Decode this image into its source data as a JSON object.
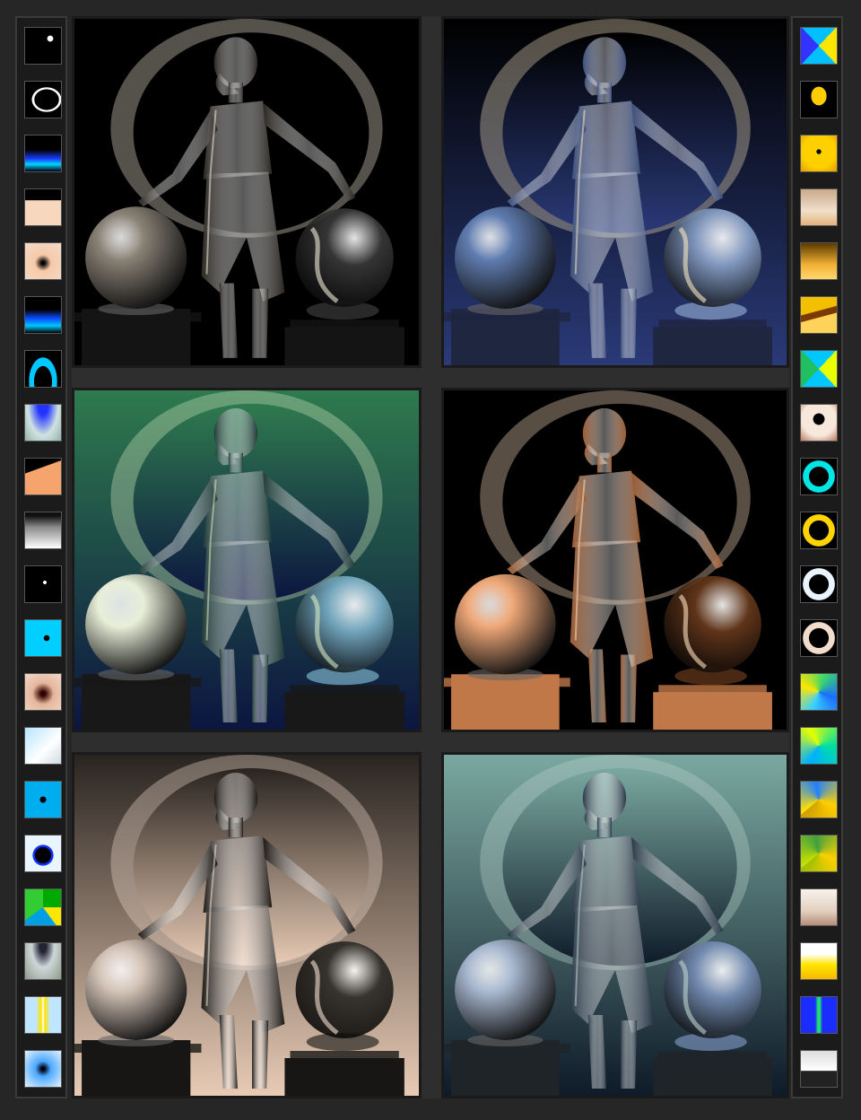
{
  "colors": {
    "background": "#262626",
    "strip": "#1b1b1b",
    "strip_border": "#3a3a3a"
  },
  "left_strip": {
    "thumbnails": [
      {
        "name": "crescent-small-preset",
        "bg": "radial-gradient(circle at 70% 30%, #ffffff 0 8%, #000 9%)"
      },
      {
        "name": "crescent-wide-preset",
        "bg": "radial-gradient(ellipse at 60% 50%, #000 0 40%, #fff 41% 48%, #000 49%)"
      },
      {
        "name": "blue-horizon-preset",
        "bg": "linear-gradient(#000 40%, #1a3cff 65%, #00d7ff 80%, #001 100%)"
      },
      {
        "name": "peach-arch-preset",
        "bg": "linear-gradient(#000 30%, #f8d7bf 31%)"
      },
      {
        "name": "peach-spot-preset",
        "bg": "radial-gradient(circle at 50% 55%, #000 0 6%, #f7c9a8 30%, #f1dccb 100%)"
      },
      {
        "name": "cyan-horizon-preset",
        "bg": "linear-gradient(#000 35%, #0a4cff 60%, #00c8ff 80%, #000 100%)"
      },
      {
        "name": "cyan-arc-preset",
        "bg": "radial-gradient(ellipse at 50% 85%, #000 0 35%, #00c8ff 36% 55%, #000 56%)"
      },
      {
        "name": "teal-dome-preset",
        "bg": "radial-gradient(ellipse at 50% 0%, #2233ff 0 20%, #cfe3e0 60%, #95b0a8 100%)"
      },
      {
        "name": "orange-peak-preset",
        "bg": "linear-gradient(160deg, #000 0 30%, #f4a46c 31% 100%)"
      },
      {
        "name": "white-cone-preset",
        "bg": "linear-gradient(#111 0 10%, #888 40%, #fff 100%)"
      },
      {
        "name": "tiny-moon-preset",
        "bg": "radial-gradient(circle at 55% 45%, #fff 0 6%, #000 7%)"
      },
      {
        "name": "cyan-dot-preset",
        "bg": "radial-gradient(circle at 60% 50%, #000 0 10%, #00cfff 11% 100%)"
      },
      {
        "name": "peach-shadow-preset",
        "bg": "radial-gradient(circle at 50% 55%, #300 0 8%, #e5b69b 40%, #f0d8c8 100%)"
      },
      {
        "name": "ice-gradient-preset",
        "bg": "linear-gradient(135deg, #b7e6ff, #ffffff 60%, #cfd9e0)"
      },
      {
        "name": "blue-dot-preset",
        "bg": "radial-gradient(circle at 50% 50%, #000 0 12%, #00aeef 13% 100%)"
      },
      {
        "name": "dark-eye-preset",
        "bg": "radial-gradient(circle at 50% 55%, #000 0 30%, #1030ff 31% 38%, #e9f6ff 40% 100%)"
      },
      {
        "name": "green-spiral-preset",
        "bg": "conic-gradient(#0a0 0 25%, #ffe600 25% 40%, #009ee3 40% 65%, #3c3 65% 100%)"
      },
      {
        "name": "gray-dome-preset",
        "bg": "radial-gradient(ellipse at 50% 10%, #223 0 12%, #cdd7d8 45%, #8f9a8c 100%)"
      },
      {
        "name": "yellow-beam-preset",
        "bg": "linear-gradient(90deg, #bfe5ff 0 30%, #ffe300 45%, #fff 50%, #ffe300 55%, #bfe5ff 70%)"
      },
      {
        "name": "blue-glow-preset",
        "bg": "radial-gradient(circle at 50% 50%, #001 0 6%, #4aa8ff 30%, #e6f3ff 100%)"
      }
    ]
  },
  "right_strip": {
    "thumbnails": [
      {
        "name": "cyan-hourglass-preset",
        "bg": "conic-gradient(#00c0ff 0 12%, #ffe600 12% 38%, #00c0ff 38% 62%, #3333ff 62% 88%, #00c0ff 88%)"
      },
      {
        "name": "yellow-bird-preset",
        "bg": "radial-gradient(ellipse at 50% 40%, #ffcc00 0 30%, #000 31%)"
      },
      {
        "name": "yellow-dot-preset",
        "bg": "radial-gradient(circle at 50% 45%, #000 0 8%, #ffd000 10% 60%, #e39b00 100%)"
      },
      {
        "name": "sand-preset",
        "bg": "linear-gradient(#c9a98a, #f2dfcc 60%, #e4b27a)"
      },
      {
        "name": "amber-preset",
        "bg": "linear-gradient(#5a3a00, #f2b134 60%, #ffd86c)"
      },
      {
        "name": "gold-ridge-preset",
        "bg": "linear-gradient(165deg, #f3c000 0 40%, #7a3b00 41% 55%, #ffd25a 56%)"
      },
      {
        "name": "yellow-hourglass-preset",
        "bg": "conic-gradient(#00c8ff 0 12%, #e9ff00 12% 38%, #00c8ff 38% 62%, #20c060 62% 88%, #00c8ff 88%)"
      },
      {
        "name": "beige-ring-preset",
        "bg": "radial-gradient(circle at 50% 40%, #000 0 20%, #f7e8dc 21% 60%, #b87c5e 100%)"
      },
      {
        "name": "cyan-ring-preset",
        "bg": "radial-gradient(circle, #000 0 38%, #00e5e5 40% 62%, #000 64%)"
      },
      {
        "name": "gold-ring-preset",
        "bg": "radial-gradient(circle, #000 0 38%, #ffd400 40% 62%, #000 64%)"
      },
      {
        "name": "white-ring-preset",
        "bg": "radial-gradient(circle, #000 0 38%, #e9f4ff 40% 62%, #000 64%)"
      },
      {
        "name": "peach-ring-preset",
        "bg": "radial-gradient(circle, #000 0 38%, #f2dccc 40% 62%, #000 64%)"
      },
      {
        "name": "rainbow-wedge-preset",
        "bg": "conic-gradient(from 200deg, #3ad0ff, #ffe600, #3bd66b, #1a6cff, #3ad0ff)"
      },
      {
        "name": "citrus-wedge-preset",
        "bg": "conic-gradient(from 210deg, #00b0ff, #e6ff00, #00e0a0, #00b0ff)"
      },
      {
        "name": "gold-fan-preset",
        "bg": "conic-gradient(from 230deg, #ffe000, #2080ff, #ffd000, #cfa000)"
      },
      {
        "name": "olive-fan-preset",
        "bg": "conic-gradient(from 230deg, #c8e000, #40a040, #ffd000, #a0c000)"
      },
      {
        "name": "cream-preset",
        "bg": "linear-gradient(#f7f3ec, #e3d0c0 60%, #b68e78)"
      },
      {
        "name": "sunrise-preset",
        "bg": "linear-gradient(#fff 0 30%, #ffe600 60%, #f6b800)"
      },
      {
        "name": "green-spike-preset",
        "bg": "linear-gradient(90deg, #1a2cff 0 40%, #20e070 47% 53%, #1a2cff 60%)"
      },
      {
        "name": "white-shield-preset",
        "bg": "linear-gradient(#ddd, #fff 55%, #222 56%)"
      }
    ]
  },
  "renders": [
    {
      "name": "render-crescent-backlit",
      "bg1": "#000000",
      "bg2": "#000000",
      "light": "#f2ead8",
      "statue": "#2a2622",
      "sphere_left": "#8a8276",
      "sphere_right": "#3a3a3a",
      "pedestal": "#141414"
    },
    {
      "name": "render-blue-horizon",
      "bg1": "#000000",
      "bg2": "#2a3a78",
      "light": "#f6e6c4",
      "statue": "#3c4e7a",
      "sphere_left": "#5f7cb0",
      "sphere_right": "#8aa2c8",
      "pedestal": "#1e2640"
    },
    {
      "name": "render-green-gradient",
      "bg1": "#2e7a4e",
      "bg2": "#0c1540",
      "light": "#d8e8c0",
      "statue": "#1f3a36",
      "sphere_left": "#e8eed8",
      "sphere_right": "#7ab0c8",
      "pedestal": "#181818"
    },
    {
      "name": "render-copper-ring",
      "bg1": "#000000",
      "bg2": "#000000",
      "light": "#ffe0c0",
      "statue": "#9a5a30",
      "sphere_left": "#f0a878",
      "sphere_right": "#6a3a1c",
      "pedestal": "#c07848"
    },
    {
      "name": "render-peach-spotlight",
      "bg1": "#2a2420",
      "bg2": "#e8cbb5",
      "light": "#f4e0d0",
      "statue": "#1c1916",
      "sphere_left": "#d2c2b6",
      "sphere_right": "#2a2824",
      "pedestal": "#181614"
    },
    {
      "name": "render-teal-studio",
      "bg1": "#7aa8a0",
      "bg2": "#0e1a28",
      "light": "#bcd4cc",
      "statue": "#2a3848",
      "sphere_left": "#a8b8d0",
      "sphere_right": "#7890b8",
      "pedestal": "#1e2428"
    }
  ]
}
